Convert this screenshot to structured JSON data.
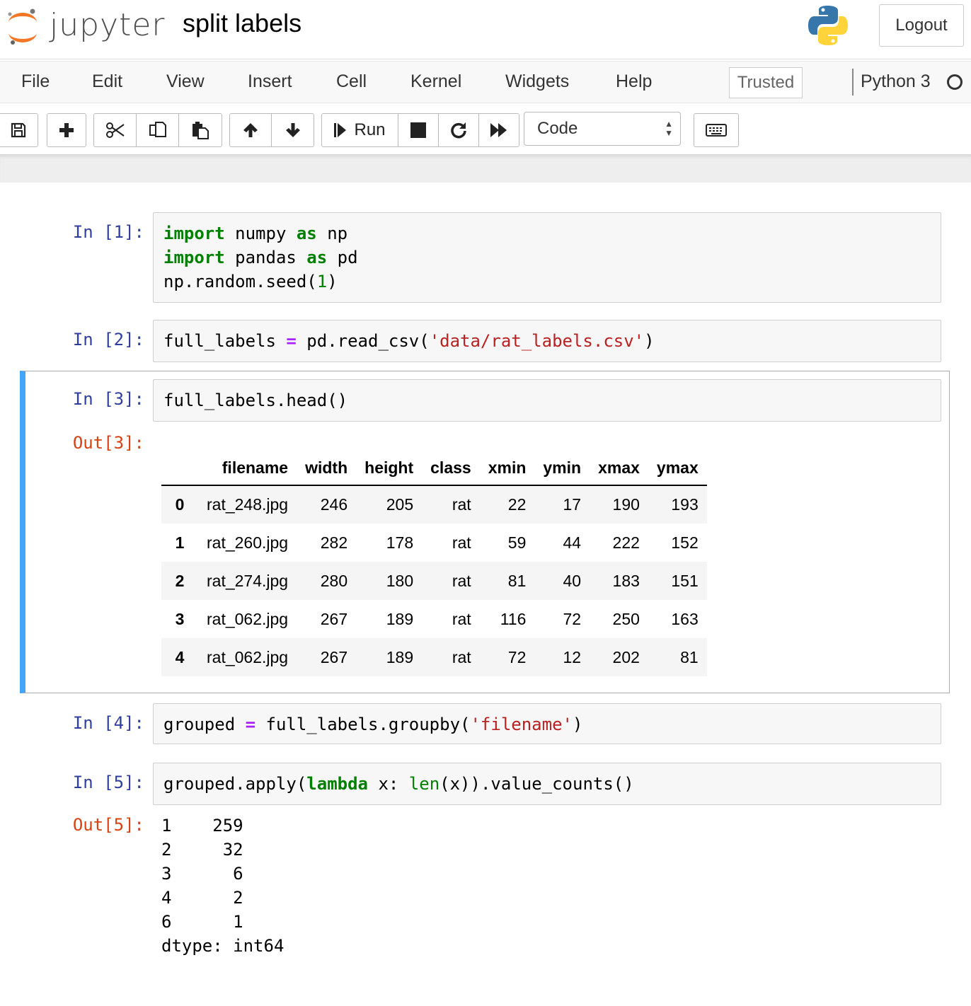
{
  "header": {
    "logo_text": "jupyter",
    "notebook_title": "split labels",
    "logout_label": "Logout"
  },
  "menubar": {
    "items": [
      "File",
      "Edit",
      "View",
      "Insert",
      "Cell",
      "Kernel",
      "Widgets",
      "Help"
    ],
    "trusted_label": "Trusted",
    "kernel_name": "Python 3"
  },
  "toolbar": {
    "run_label": "Run",
    "cell_type": "Code",
    "icons": [
      "save-icon",
      "plus-icon",
      "cut-icon",
      "copy-icon",
      "paste-icon",
      "arrow-up-icon",
      "arrow-down-icon",
      "step-run-icon",
      "stop-icon",
      "restart-icon",
      "fast-forward-icon",
      "keyboard-icon"
    ]
  },
  "cells": [
    {
      "prompt": "In [1]:",
      "lines": [
        [
          {
            "t": "import",
            "c": "kw"
          },
          {
            "t": " numpy "
          },
          {
            "t": "as",
            "c": "kw"
          },
          {
            "t": " np"
          }
        ],
        [
          {
            "t": "import",
            "c": "kw"
          },
          {
            "t": " pandas "
          },
          {
            "t": "as",
            "c": "kw"
          },
          {
            "t": " pd"
          }
        ],
        [
          {
            "t": "np.random.seed("
          },
          {
            "t": "1",
            "c": "num"
          },
          {
            "t": ")"
          }
        ]
      ]
    },
    {
      "prompt": "In [2]:",
      "lines": [
        [
          {
            "t": "full_labels "
          },
          {
            "t": "=",
            "c": "op"
          },
          {
            "t": " pd.read_csv("
          },
          {
            "t": "'data/rat_labels.csv'",
            "c": "str"
          },
          {
            "t": ")"
          }
        ]
      ]
    },
    {
      "prompt": "In [3]:",
      "lines": [
        [
          {
            "t": "full_labels.head()"
          }
        ]
      ],
      "out_prompt": "Out[3]:",
      "table": {
        "columns": [
          "",
          "filename",
          "width",
          "height",
          "class",
          "xmin",
          "ymin",
          "xmax",
          "ymax"
        ],
        "rows": [
          [
            "0",
            "rat_248.jpg",
            "246",
            "205",
            "rat",
            "22",
            "17",
            "190",
            "193"
          ],
          [
            "1",
            "rat_260.jpg",
            "282",
            "178",
            "rat",
            "59",
            "44",
            "222",
            "152"
          ],
          [
            "2",
            "rat_274.jpg",
            "280",
            "180",
            "rat",
            "81",
            "40",
            "183",
            "151"
          ],
          [
            "3",
            "rat_062.jpg",
            "267",
            "189",
            "rat",
            "116",
            "72",
            "250",
            "163"
          ],
          [
            "4",
            "rat_062.jpg",
            "267",
            "189",
            "rat",
            "72",
            "12",
            "202",
            "81"
          ]
        ]
      }
    },
    {
      "prompt": "In [4]:",
      "lines": [
        [
          {
            "t": "grouped "
          },
          {
            "t": "=",
            "c": "op"
          },
          {
            "t": " full_labels.groupby("
          },
          {
            "t": "'filename'",
            "c": "str"
          },
          {
            "t": ")"
          }
        ]
      ]
    },
    {
      "prompt": "In [5]:",
      "lines": [
        [
          {
            "t": "grouped.apply("
          },
          {
            "t": "lambda",
            "c": "kw"
          },
          {
            "t": " x: "
          },
          {
            "t": "len",
            "c": "bi"
          },
          {
            "t": "(x)).value_counts()"
          }
        ]
      ],
      "out_prompt": "Out[5]:",
      "output": "1    259\n2     32\n3      6\n4      2\n6      1\ndtype: int64"
    }
  ],
  "colors": {
    "selected_cell_border": "#42a5f5",
    "in_prompt": "#303f9f",
    "out_prompt": "#d84315",
    "keyword": "#008000",
    "string": "#ba2121",
    "operator": "#aa22ff"
  }
}
